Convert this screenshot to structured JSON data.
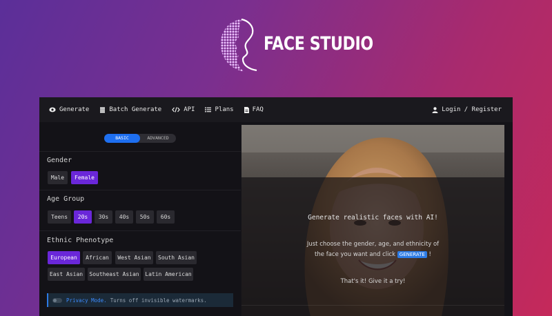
{
  "brand": {
    "name": "FACE STUDIO"
  },
  "navbar": {
    "items": [
      {
        "label": "Generate",
        "icon": "eye-icon"
      },
      {
        "label": "Batch Generate",
        "icon": "layers-icon"
      },
      {
        "label": "API",
        "icon": "code-icon"
      },
      {
        "label": "Plans",
        "icon": "list-icon"
      },
      {
        "label": "FAQ",
        "icon": "document-icon"
      }
    ],
    "login": {
      "label": "Login / Register",
      "icon": "user-icon"
    }
  },
  "mode_toggle": {
    "options": [
      "BASIC",
      "ADVANCED"
    ],
    "selected": "BASIC"
  },
  "gender": {
    "title": "Gender",
    "options": [
      "Male",
      "Female"
    ],
    "selected": "Female"
  },
  "age_group": {
    "title": "Age Group",
    "options": [
      "Teens",
      "20s",
      "30s",
      "40s",
      "50s",
      "60s"
    ],
    "selected": "20s"
  },
  "ethnic": {
    "title": "Ethnic Phenotype",
    "options": [
      "European",
      "African",
      "West Asian",
      "South Asian",
      "East Asian",
      "Southeast Asian",
      "Latin American"
    ],
    "selected": "European"
  },
  "privacy": {
    "label": "Privacy Mode.",
    "text": "Turns off invisible watermarks."
  },
  "hero": {
    "headline": "Generate realistic faces with AI!",
    "line1": "Just choose the gender, age, and ethnicity of",
    "line2_pre": "the face you want and click",
    "button": "GENERATE",
    "line2_post": "!",
    "cta": "That's it! Give it a try!"
  },
  "colors": {
    "accent_purple": "#6a27d9",
    "accent_blue": "#2c7be5",
    "panel_bg": "#141318"
  }
}
